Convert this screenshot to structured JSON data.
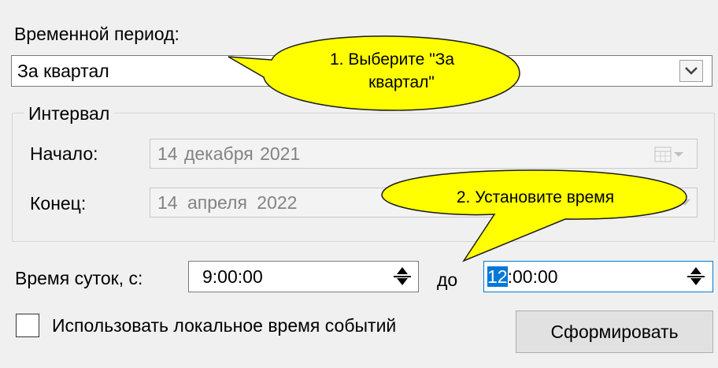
{
  "period": {
    "label": "Временной период:",
    "selected": "За квартал"
  },
  "interval": {
    "group_label": "Интервал",
    "start_label": "Начало:",
    "start_value": "14  декабря  2021",
    "end_label": "Конец:",
    "end_value": "14  апреля   2022"
  },
  "time_of_day": {
    "label": "Время суток, с:",
    "from_value": "9:00:00",
    "to_label": "до",
    "to_value_highlight": "12",
    "to_value_rest": ":00:00"
  },
  "local_time_checkbox": {
    "label": "Использовать локальное время событий",
    "checked": false
  },
  "generate_button": "Сформировать",
  "callouts": {
    "first_line1": "1. Выберите \"За",
    "first_line2": "квартал\"",
    "second": "2. Установите время"
  },
  "colors": {
    "callout_fill": "#ffff00",
    "window_bg": "#f0f0f0",
    "selection": "#0078d7"
  },
  "icons": {
    "dropdown": "chevron-down-icon",
    "calendar": "calendar-icon",
    "spinner": "spinner-icon"
  }
}
